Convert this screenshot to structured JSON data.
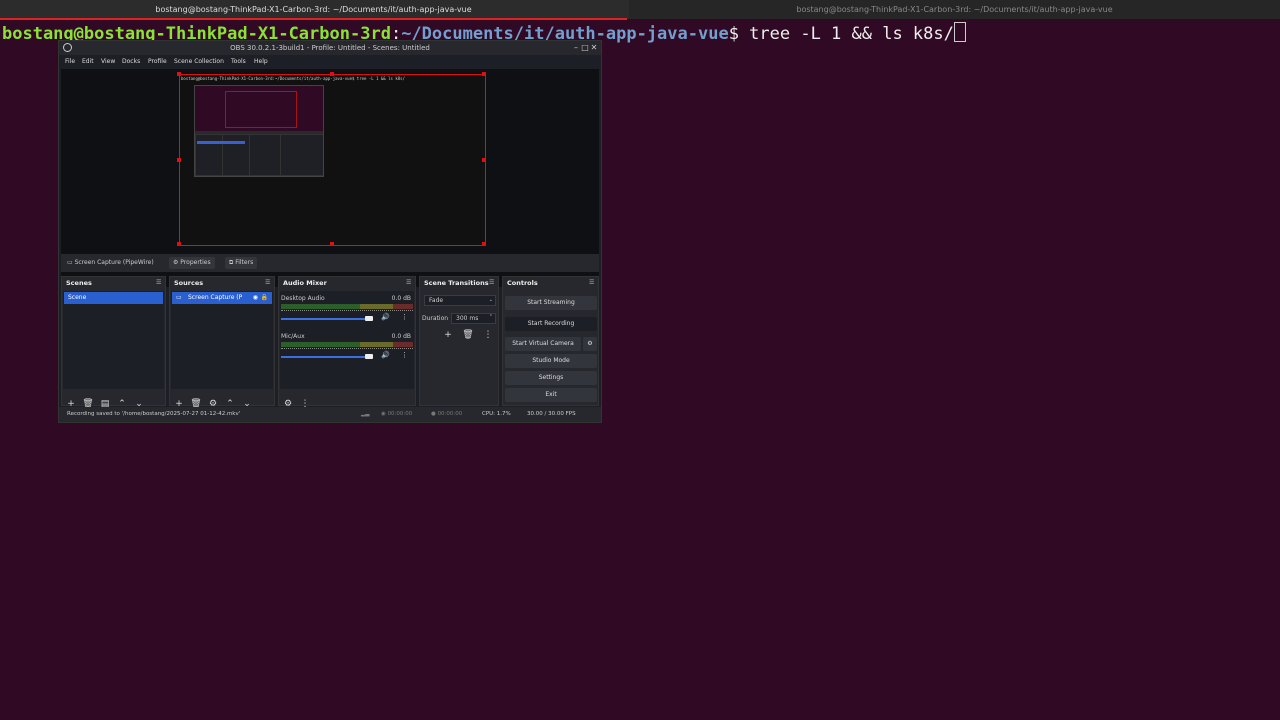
{
  "tabs": [
    {
      "label": "bostang@bostang-ThinkPad-X1-Carbon-3rd: ~/Documents/it/auth-app-java-vue",
      "active": true
    },
    {
      "label": "bostang@bostang-ThinkPad-X1-Carbon-3rd: ~/Documents/it/auth-app-java-vue",
      "active": false
    }
  ],
  "terminal": {
    "user_host": "bostang@bostang-ThinkPad-X1-Carbon-3rd",
    "colon": ":",
    "path": "~/Documents/it/auth-app-java-vue",
    "command": "$ tree -L 1 && ls k8s/"
  },
  "obs": {
    "title": "OBS 30.0.2.1-3build1 - Profile: Untitled - Scenes: Untitled",
    "menu": [
      "File",
      "Edit",
      "View",
      "Docks",
      "Profile",
      "Scene Collection",
      "Tools",
      "Help"
    ],
    "preview_text": "bostang@bostang-ThinkPad-X1-Carbon-3rd:~/Documents/it/auth-app-java-vue$ tree -L 1 && ls k8s/",
    "source_bar": {
      "source": "Screen Capture (PipeWire)",
      "properties": "Properties",
      "filters": "Filters"
    },
    "scenes": {
      "title": "Scenes",
      "items": [
        "Scene"
      ]
    },
    "sources": {
      "title": "Sources",
      "items": [
        "Screen Capture (P"
      ]
    },
    "mixer": {
      "title": "Audio Mixer",
      "channels": [
        {
          "name": "Desktop Audio",
          "db": "0.0 dB",
          "level": 0.95
        },
        {
          "name": "Mic/Aux",
          "db": "0.0 dB",
          "level": 0.95
        }
      ]
    },
    "transitions": {
      "title": "Scene Transitions",
      "selected": "Fade",
      "duration_label": "Duration",
      "duration_value": "300 ms"
    },
    "controls": {
      "title": "Controls",
      "start_streaming": "Start Streaming",
      "start_recording": "Start Recording",
      "start_virtual_camera": "Start Virtual Camera",
      "studio_mode": "Studio Mode",
      "settings": "Settings",
      "exit": "Exit"
    },
    "status": {
      "message": "Recording saved to '/home/bostang/2025-07-27 01-12-42.mkv'",
      "stream_time": "00:00:00",
      "rec_time": "00:00:00",
      "cpu": "CPU: 1.7%",
      "fps": "30.00 / 30.00 FPS"
    }
  },
  "colors": {
    "terminal_bg": "#300a24",
    "prompt_user": "#8ae234",
    "prompt_path": "#729fcf",
    "selection_blue": "#2a5fd0",
    "canvas_border": "#dd1111"
  }
}
